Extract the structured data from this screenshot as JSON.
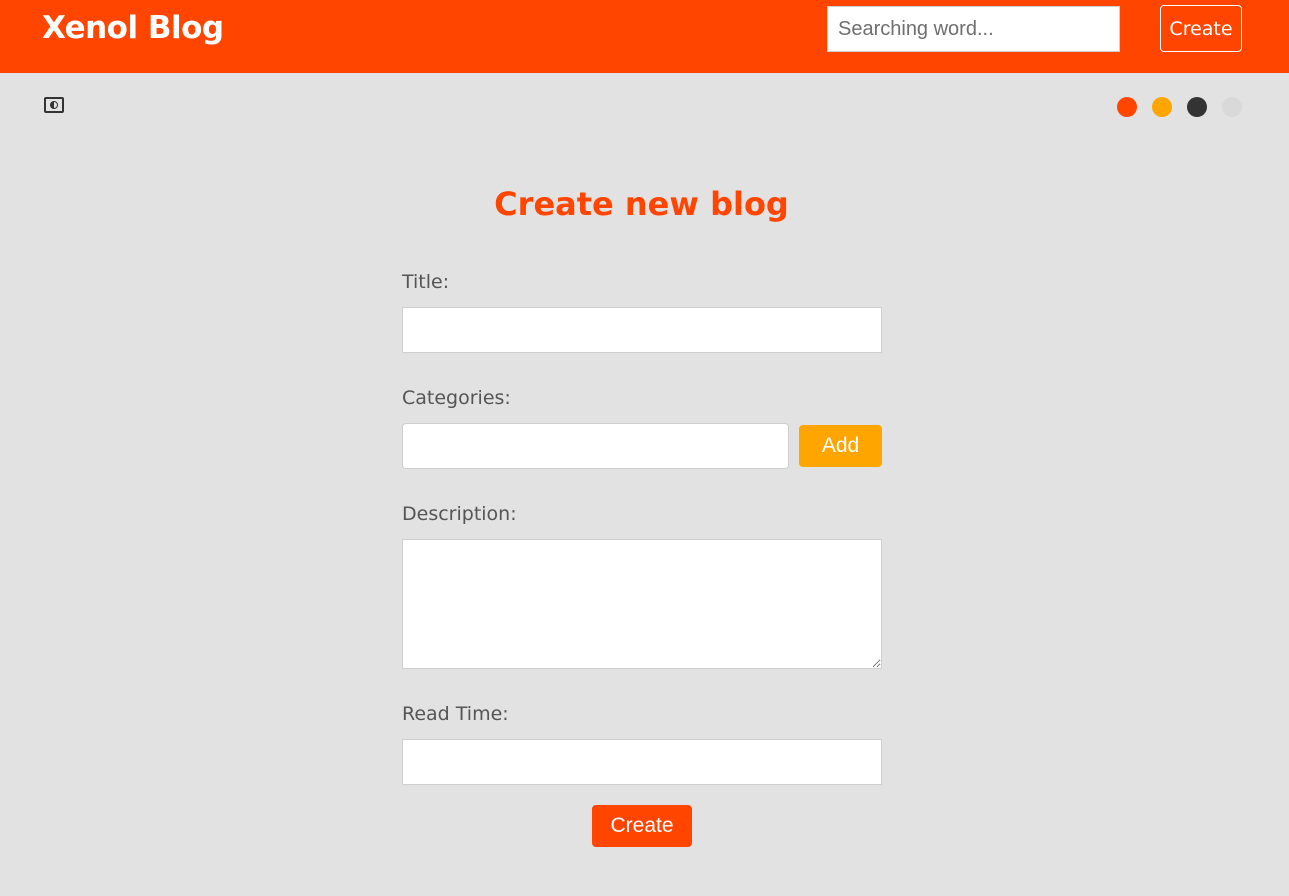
{
  "navbar": {
    "brand": "Xenol Blog",
    "search_placeholder": "Searching word...",
    "create_label": "Create",
    "color": "#ff4500"
  },
  "toolbar": {
    "theme_icon": "contrast-toggle-icon",
    "swatches": [
      {
        "name": "orange-red",
        "color": "#ff4500"
      },
      {
        "name": "orange",
        "color": "#ffa500"
      },
      {
        "name": "dark",
        "color": "#333333"
      },
      {
        "name": "light",
        "color": "#d9d9d9"
      }
    ]
  },
  "form": {
    "heading": "Create new blog",
    "title_label": "Title:",
    "title_value": "",
    "categories_label": "Categories:",
    "categories_value": "",
    "add_label": "Add",
    "description_label": "Description:",
    "description_value": "",
    "read_time_label": "Read Time:",
    "read_time_value": "",
    "submit_label": "Create"
  }
}
